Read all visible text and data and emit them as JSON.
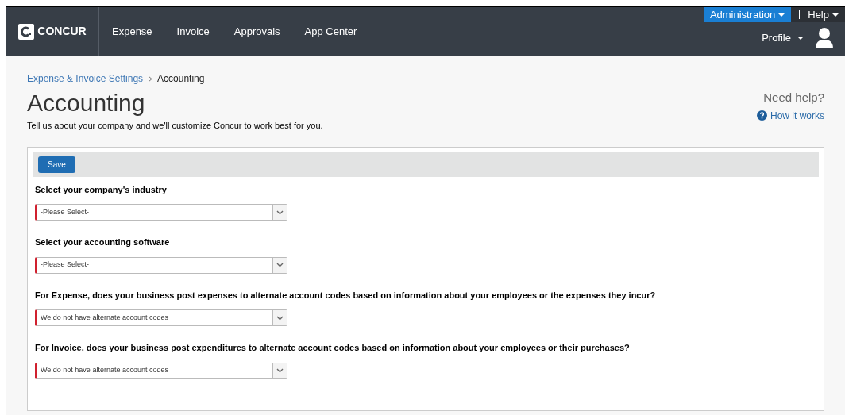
{
  "header": {
    "logo": "CONCUR",
    "nav": [
      "Expense",
      "Invoice",
      "Approvals",
      "App Center"
    ],
    "admin_menu": "Administration",
    "help_menu": "Help",
    "profile_menu": "Profile"
  },
  "breadcrumb": [
    {
      "label": "Expense & Invoice Settings",
      "link": true
    },
    {
      "label": "Accounting",
      "link": false
    }
  ],
  "page": {
    "title": "Accounting",
    "subtitle": "Tell us about your company and we'll customize Concur to work best for you.",
    "help_title": "Need help?",
    "help_link": "How it works"
  },
  "form": {
    "save_button": "Save",
    "questions": [
      {
        "label": "Select your company's industry",
        "value": "-Please Select-",
        "required": true
      },
      {
        "label": "Select your accounting software",
        "value": "-Please Select-",
        "required": true
      },
      {
        "label": "For Expense, does your business post expenses to alternate account codes based on information about your employees or the expenses they incur?",
        "value": "We do not have alternate account codes",
        "required": true
      },
      {
        "label": "For Invoice, does your business post expenditures to alternate account codes based on information about your employees or their purchases?",
        "value": "We do not have alternate account codes",
        "required": true
      }
    ]
  }
}
